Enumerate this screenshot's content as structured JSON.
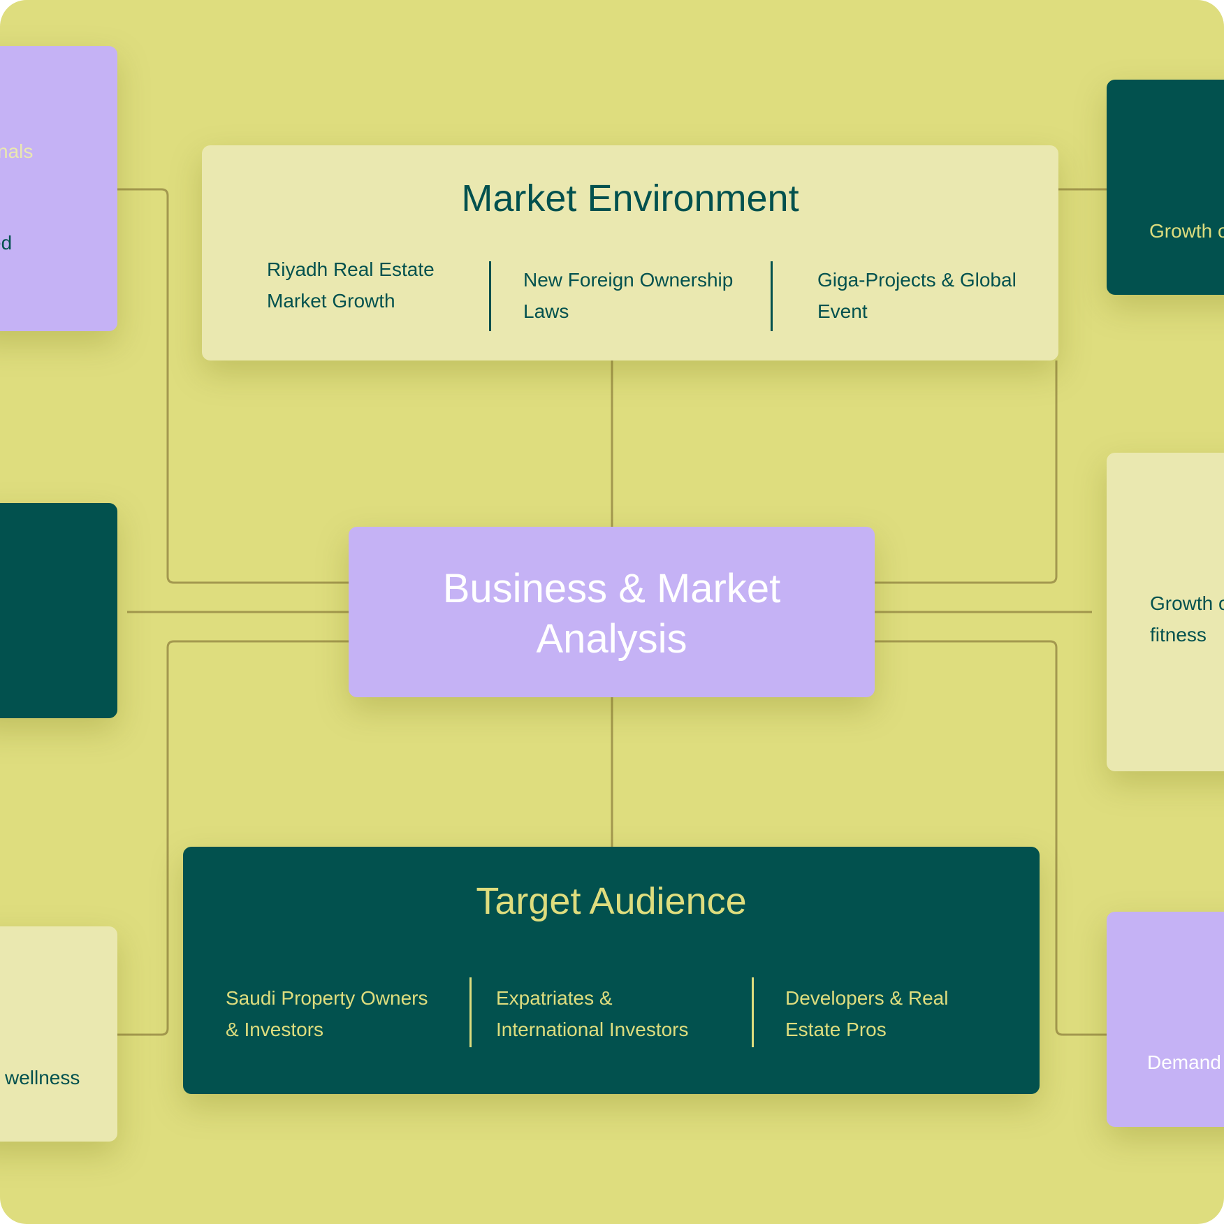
{
  "colors": {
    "background": "#dedd7e",
    "lavender": "#c5b2f5",
    "dark_teal": "#02514e",
    "cream": "#eae8b0",
    "connector": "#a3984f",
    "light_text": "#eae8b0",
    "white": "#ffffff"
  },
  "center": {
    "title_line1": "Business & Market",
    "title_line2": "Analysis"
  },
  "market_environment": {
    "title": "Market Environment",
    "items": [
      {
        "line1": "Riyadh Real Estate",
        "line2": "Market Growth"
      },
      {
        "line1": "New Foreign Ownership",
        "line2": "Laws"
      },
      {
        "line1": "Giga-Projects & Global",
        "line2": "Event"
      }
    ]
  },
  "target_audience": {
    "title": "Target Audience",
    "items": [
      {
        "line1": "Saudi Property Owners",
        "line2": "& Investors"
      },
      {
        "line1": "Expatriates &",
        "line2": "International Investors"
      },
      {
        "line1": "Developers & Real",
        "line2": "Estate Pros"
      }
    ]
  },
  "side_cards": {
    "left_top": "ed",
    "left_middle": "nals",
    "left_bottom": "wellness",
    "right_top": "Growth o",
    "right_middle_line1": "Growth o",
    "right_middle_line2": "fitness",
    "right_bottom": "Demand"
  }
}
